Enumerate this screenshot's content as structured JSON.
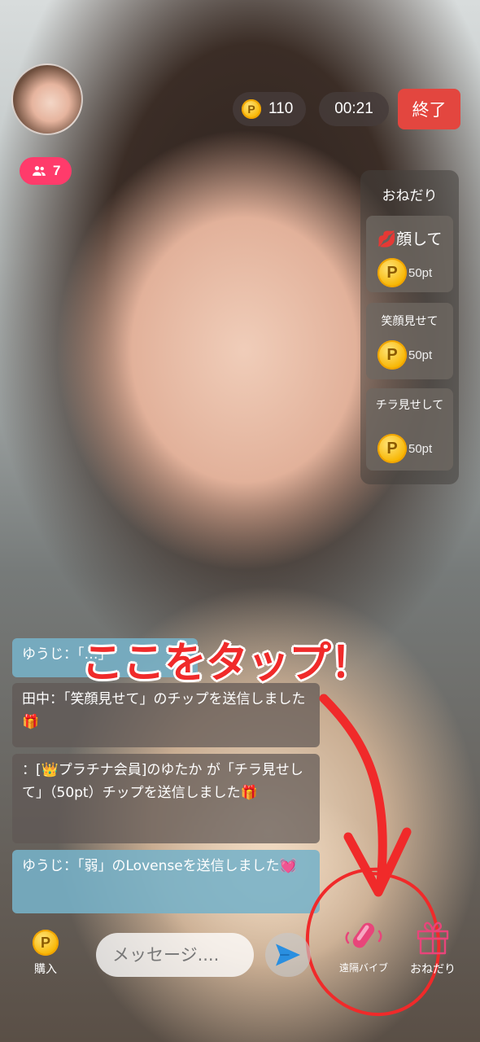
{
  "header": {
    "viewer_count": "7",
    "points_balance": "110",
    "timer": "00:21",
    "end_label": "終了"
  },
  "onedari_panel": {
    "title": "おねだり",
    "requests": [
      {
        "emoji": "💋",
        "label": "顔して",
        "price": "50pt"
      },
      {
        "label": "笑顔見せて",
        "price": "50pt"
      },
      {
        "label": "チラ見せして",
        "price": "50pt"
      }
    ]
  },
  "annotation": {
    "text": "ここをタップ！"
  },
  "chat": {
    "messages": [
      {
        "type": "user",
        "text": "ゆうじ：「…」"
      },
      {
        "type": "system",
        "text": "田中：「笑顔見せて」のチップを送信しました🎁"
      },
      {
        "type": "system",
        "text": "：[👑プラチナ会員]のゆたか が「チラ見せして」（50pt）チップを送信しました🎁"
      },
      {
        "type": "user",
        "text": "ゆうじ：「弱」のLovenseを送信しました💓"
      }
    ]
  },
  "bottom_bar": {
    "buy_label": "購入",
    "message_placeholder": "メッセージ....",
    "vibe_label": "遠隔バイブ",
    "onedari_label": "おねだり"
  },
  "colors": {
    "end_button": "#e3463f",
    "viewer_badge": "#ff3b6b",
    "annotation_red": "#f02a2a",
    "vibe_icon": "#e8457a",
    "send_icon": "#2a8fe0",
    "coin": "#f7b500"
  }
}
